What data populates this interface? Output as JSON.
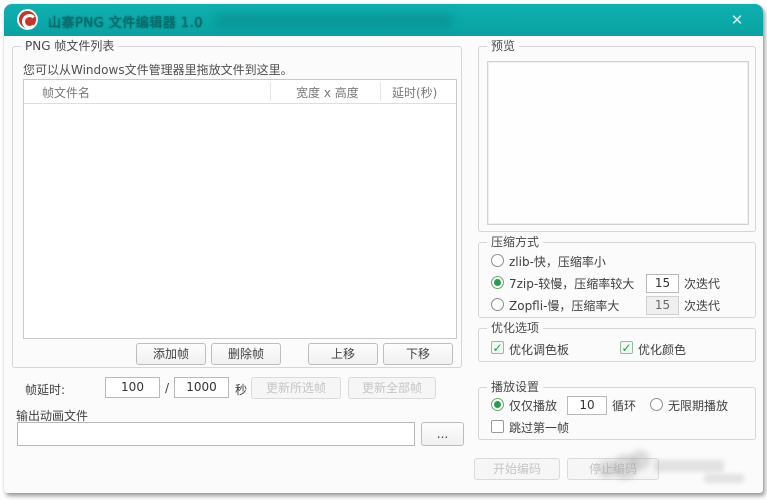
{
  "window": {
    "title": "山寨PNG 文件编辑器 1.0",
    "close_glyph": "✕"
  },
  "frame_list": {
    "group_label": "PNG 帧文件列表",
    "hint": "您可以从Windows文件管理器里拖放文件到这里。",
    "columns": [
      "帧文件名",
      "宽度 x 高度",
      "延时(秒)"
    ],
    "rows": [],
    "buttons": {
      "add": "添加帧",
      "remove": "删除帧",
      "move_up": "上移",
      "move_down": "下移"
    }
  },
  "delay_row": {
    "label": "帧延时:",
    "numerator": "100",
    "separator": "/",
    "denominator": "1000",
    "unit": "秒",
    "update_selected": "更新所选帧",
    "update_all": "更新全部帧"
  },
  "output": {
    "label": "输出动画文件",
    "path_value": "",
    "browse": "..."
  },
  "preview": {
    "group_label": "预览"
  },
  "compression": {
    "group_label": "压缩方式",
    "options": [
      {
        "label": "zlib-快，压缩率小",
        "selected": false
      },
      {
        "label": "7zip-较慢，压缩率较大",
        "selected": true,
        "iterations": "15",
        "iter_label": "次迭代"
      },
      {
        "label": "Zopfli-慢，压缩率大",
        "selected": false,
        "iterations": "15",
        "iter_label": "次迭代"
      }
    ]
  },
  "optimization": {
    "group_label": "优化选项",
    "checkboxes": [
      {
        "label": "优化调色板",
        "checked": true
      },
      {
        "label": "优化颜色",
        "checked": true
      }
    ]
  },
  "playback": {
    "group_label": "播放设置",
    "play_only_label": "仅仅播放",
    "loops_value": "10",
    "loops_unit": "循环",
    "play_only_selected": true,
    "infinite_label": "无限期播放",
    "infinite_selected": false,
    "skip_first_label": "跳过第一帧",
    "skip_first_checked": false
  },
  "actions": {
    "start_encode": "开始编码",
    "stop_encode": "停止编码"
  },
  "colors": {
    "titlebar_teal": "#0ba8a8",
    "accent_green": "#1fa04c",
    "app_icon_red": "#c8342c"
  }
}
